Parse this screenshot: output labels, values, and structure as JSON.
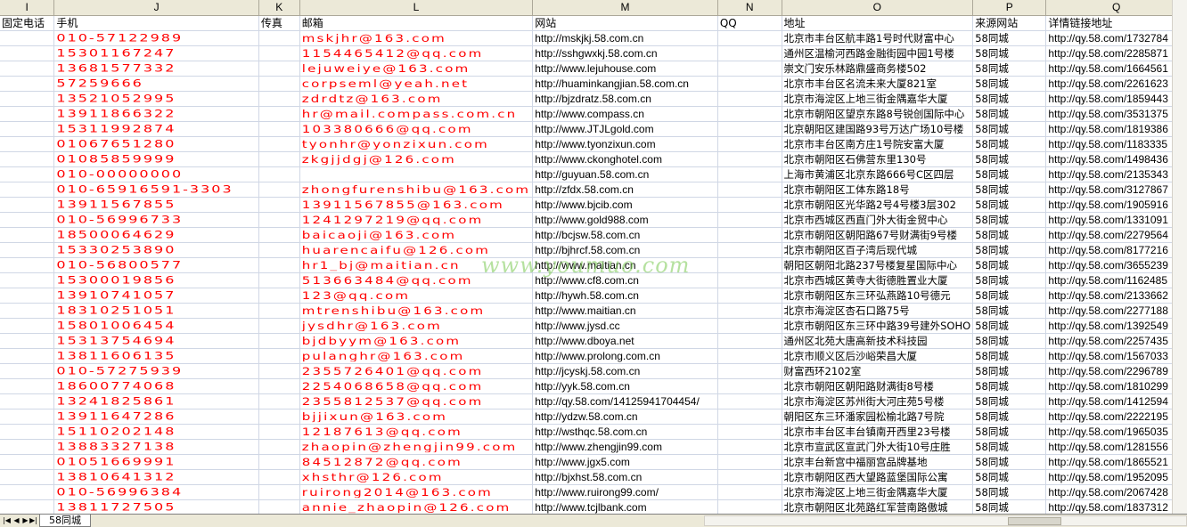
{
  "columns": [
    {
      "letter": "I",
      "header": "固定电话"
    },
    {
      "letter": "J",
      "header": "手机"
    },
    {
      "letter": "K",
      "header": "传真"
    },
    {
      "letter": "L",
      "header": "邮箱"
    },
    {
      "letter": "M",
      "header": "网站"
    },
    {
      "letter": "N",
      "header": "QQ"
    },
    {
      "letter": "O",
      "header": "地址"
    },
    {
      "letter": "P",
      "header": "来源网站"
    },
    {
      "letter": "Q",
      "header": "详情链接地址"
    }
  ],
  "rows": [
    {
      "i": "",
      "j": "010-57122989",
      "k": "",
      "l": "mskjhr@163.com",
      "m": "http://mskjkj.58.com.cn",
      "n": "",
      "o": "北京市丰台区航丰路1号时代财富中心",
      "p": "58同城",
      "q": "http://qy.58.com/1732784"
    },
    {
      "i": "",
      "j": "15301167247",
      "k": "",
      "l": "1154465412@qq.com",
      "m": "http://sshgwxkj.58.com.cn",
      "n": "",
      "o": "通州区温榆河西路金融街园中园1号楼",
      "p": "58同城",
      "q": "http://qy.58.com/2285871"
    },
    {
      "i": "",
      "j": "13681577332",
      "k": "",
      "l": "lejuweiye@163.com",
      "m": "http://www.lejuhouse.com",
      "n": "",
      "o": "崇文门安乐林路鼎盛商务楼502",
      "p": "58同城",
      "q": "http://qy.58.com/1664561"
    },
    {
      "i": "",
      "j": "57259666",
      "k": "",
      "l": "corpseml@yeah.net",
      "m": "http://huaminkangjian.58.com.cn",
      "n": "",
      "o": "北京市丰台区名流未来大厦821室",
      "p": "58同城",
      "q": "http://qy.58.com/2261623"
    },
    {
      "i": "",
      "j": "13521052995",
      "k": "",
      "l": "zdrdtz@163.com",
      "m": "http://bjzdratz.58.com.cn",
      "n": "",
      "o": "北京市海淀区上地三街金隅嘉华大厦",
      "p": "58同城",
      "q": "http://qy.58.com/1859443"
    },
    {
      "i": "",
      "j": "13911866322",
      "k": "",
      "l": "hr@mail.compass.com.cn",
      "m": "http://www.compass.cn",
      "n": "",
      "o": "北京市朝阳区望京东路8号锐创国际中心",
      "p": "58同城",
      "q": "http://qy.58.com/3531375"
    },
    {
      "i": "",
      "j": "15311992874",
      "k": "",
      "l": "103380666@qq.com",
      "m": "http://www.JTJLgold.com",
      "n": "",
      "o": "北京朝阳区建国路93号万达广场10号楼",
      "p": "58同城",
      "q": "http://qy.58.com/1819386"
    },
    {
      "i": "",
      "j": "01067651280",
      "k": "",
      "l": "tyonhr@yonzixun.com",
      "m": "http://www.tyonzixun.com",
      "n": "",
      "o": "北京市丰台区南方庄1号院安富大厦",
      "p": "58同城",
      "q": "http://qy.58.com/1183335"
    },
    {
      "i": "",
      "j": "01085859999",
      "k": "",
      "l": "zkgjjdgj@126.com",
      "m": "http://www.ckonghotel.com",
      "n": "",
      "o": "北京市朝阳区石佛营东里130号",
      "p": "58同城",
      "q": "http://qy.58.com/1498436"
    },
    {
      "i": "",
      "j": "010-00000000",
      "k": "",
      "l": "",
      "m": "http://guyuan.58.com.cn",
      "n": "",
      "o": "上海市黄浦区北京东路666号C区四层",
      "p": "58同城",
      "q": "http://qy.58.com/2135343"
    },
    {
      "i": "",
      "j": "010-65916591-3303",
      "k": "",
      "l": "zhongfurenshibu@163.com",
      "m": "http://zfdx.58.com.cn",
      "n": "",
      "o": "北京市朝阳区工体东路18号",
      "p": "58同城",
      "q": "http://qy.58.com/3127867"
    },
    {
      "i": "",
      "j": "13911567855",
      "k": "",
      "l": "13911567855@163.com",
      "m": "http://www.bjcib.com",
      "n": "",
      "o": "北京市朝阳区光华路2号4号楼3层302",
      "p": "58同城",
      "q": "http://qy.58.com/1905916"
    },
    {
      "i": "",
      "j": "010-56996733",
      "k": "",
      "l": "1241297219@qq.com",
      "m": "http://www.gold988.com",
      "n": "",
      "o": "北京市西城区西直门外大街金贸中心",
      "p": "58同城",
      "q": "http://qy.58.com/1331091"
    },
    {
      "i": "",
      "j": "18500064629",
      "k": "",
      "l": "baicaoji@163.com",
      "m": "http://bcjsw.58.com.cn",
      "n": "",
      "o": "北京市朝阳区朝阳路67号财满街9号楼",
      "p": "58同城",
      "q": "http://qy.58.com/2279564"
    },
    {
      "i": "",
      "j": "15330253890",
      "k": "",
      "l": "huarencaifu@126.com",
      "m": "http://bjhrcf.58.com.cn",
      "n": "",
      "o": "北京市朝阳区百子湾后现代城",
      "p": "58同城",
      "q": "http://qy.58.com/8177216"
    },
    {
      "i": "",
      "j": "010-56800577",
      "k": "",
      "l": "hr1_bj@maitian.cn",
      "m": "http://www.maitian.cn",
      "n": "",
      "o": "朝阳区朝阳北路237号楼复星国际中心",
      "p": "58同城",
      "q": "http://qy.58.com/3655239"
    },
    {
      "i": "",
      "j": "15300019856",
      "k": "",
      "l": "513663484@qq.com",
      "m": "http://www.cf8.com.cn",
      "n": "",
      "o": "北京市西城区黄寺大街德胜置业大厦",
      "p": "58同城",
      "q": "http://qy.58.com/1162485"
    },
    {
      "i": "",
      "j": "13910741057",
      "k": "",
      "l": "123@qq.com",
      "m": "http://hywh.58.com.cn",
      "n": "",
      "o": "北京市朝阳区东三环弘燕路10号德元",
      "p": "58同城",
      "q": "http://qy.58.com/2133662"
    },
    {
      "i": "",
      "j": "18310251051",
      "k": "",
      "l": "mtrenshibu@163.com",
      "m": "http://www.maitian.cn",
      "n": "",
      "o": "北京市海淀区杏石口路75号",
      "p": "58同城",
      "q": "http://qy.58.com/2277188"
    },
    {
      "i": "",
      "j": "15801006454",
      "k": "",
      "l": "jysdhr@163.com",
      "m": "http://www.jysd.cc",
      "n": "",
      "o": "北京市朝阳区东三环中路39号建外SOHO",
      "p": "58同城",
      "q": "http://qy.58.com/1392549"
    },
    {
      "i": "",
      "j": "15313754694",
      "k": "",
      "l": "bjdbyym@163.com",
      "m": "http://www.dboya.net",
      "n": "",
      "o": "通州区北苑大唐高新技术科技园",
      "p": "58同城",
      "q": "http://qy.58.com/2257435"
    },
    {
      "i": "",
      "j": "13811606135",
      "k": "",
      "l": "pulanghr@163.com",
      "m": "http://www.prolong.com.cn",
      "n": "",
      "o": "北京市顺义区后沙峪荣昌大厦",
      "p": "58同城",
      "q": "http://qy.58.com/1567033"
    },
    {
      "i": "",
      "j": "010-57275939",
      "k": "",
      "l": "2355726401@qq.com",
      "m": "http://jcyskj.58.com.cn",
      "n": "",
      "o": "财富西环2102室",
      "p": "58同城",
      "q": "http://qy.58.com/2296789"
    },
    {
      "i": "",
      "j": "18600774068",
      "k": "",
      "l": "2254068658@qq.com",
      "m": "http://yyk.58.com.cn",
      "n": "",
      "o": "北京市朝阳区朝阳路财满街8号楼",
      "p": "58同城",
      "q": "http://qy.58.com/1810299"
    },
    {
      "i": "",
      "j": "13241825861",
      "k": "",
      "l": "2355812537@qq.com",
      "m": "http://qy.58.com/14125941704454/",
      "n": "",
      "o": "北京市海淀区苏州街大河庄苑5号楼",
      "p": "58同城",
      "q": "http://qy.58.com/1412594"
    },
    {
      "i": "",
      "j": "13911647286",
      "k": "",
      "l": "bjjixun@163.com",
      "m": "http://ydzw.58.com.cn",
      "n": "",
      "o": "朝阳区东三环潘家园松榆北路7号院",
      "p": "58同城",
      "q": "http://qy.58.com/2222195"
    },
    {
      "i": "",
      "j": "15110202148",
      "k": "",
      "l": "12187613@qq.com",
      "m": "http://wsthqc.58.com.cn",
      "n": "",
      "o": "北京市丰台区丰台镇南开西里23号楼",
      "p": "58同城",
      "q": "http://qy.58.com/1965035"
    },
    {
      "i": "",
      "j": "13883327138",
      "k": "",
      "l": "zhaopin@zhengjin99.com",
      "m": "http://www.zhengjin99.com",
      "n": "",
      "o": "北京市宣武区宣武门外大街10号庄胜",
      "p": "58同城",
      "q": "http://qy.58.com/1281556"
    },
    {
      "i": "",
      "j": "01051669991",
      "k": "",
      "l": "84512872@qq.com",
      "m": "http://www.jgx5.com",
      "n": "",
      "o": "北京丰台新宫中福丽宫品牌基地",
      "p": "58同城",
      "q": "http://qy.58.com/1865521"
    },
    {
      "i": "",
      "j": "13810641312",
      "k": "",
      "l": "xhsthr@126.com",
      "m": "http://bjxhst.58.com.cn",
      "n": "",
      "o": "北京市朝阳区西大望路蓝堡国际公寓",
      "p": "58同城",
      "q": "http://qy.58.com/1952095"
    },
    {
      "i": "",
      "j": "010-56996384",
      "k": "",
      "l": "ruirong2014@163.com",
      "m": "http://www.ruirong99.com/",
      "n": "",
      "o": "北京市海淀区上地三街金隅嘉华大厦",
      "p": "58同城",
      "q": "http://qy.58.com/2067428"
    },
    {
      "i": "",
      "j": "13811727505",
      "k": "",
      "l": "annie_zhaopin@126.com",
      "m": "http://www.tcjlbank.com",
      "n": "",
      "o": "北京市朝阳区北苑路红军营南路傲城",
      "p": "58同城",
      "q": "http://qy.58.com/1837312"
    }
  ],
  "watermark": "www.youmuo.com",
  "sheet_tab": "58同城",
  "nav_icons": [
    "first-sheet-icon",
    "prev-sheet-icon",
    "next-sheet-icon",
    "last-sheet-icon"
  ]
}
